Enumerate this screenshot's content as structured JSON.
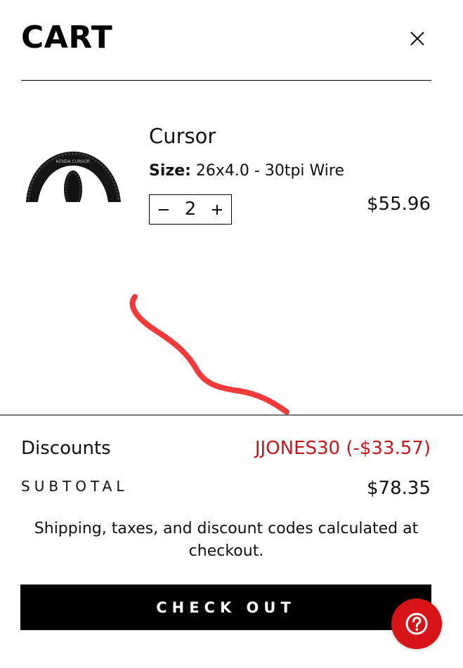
{
  "header": {
    "title": "CART",
    "close_icon": "close-icon"
  },
  "cart_item": {
    "name": "Cursor",
    "size_label": "Size:",
    "size_value": "26x4.0 - 30tpi Wire",
    "quantity": "2",
    "price": "$55.96",
    "decrease_icon": "minus-icon",
    "increase_icon": "plus-icon",
    "image_icon": "tire-image",
    "tire_brand_text": "KENDA CURSOR"
  },
  "summary": {
    "discounts_label": "Discounts",
    "discounts_value": "JJONES30 (-$33.57)",
    "subtotal_label": "SUBTOTAL",
    "subtotal_value": "$78.35",
    "shipping_note": "Shipping, taxes, and discount codes calculated at checkout."
  },
  "actions": {
    "checkout_label": "CHECK OUT",
    "help_icon": "help-icon"
  },
  "colors": {
    "accent_red": "#c4161c",
    "help_red": "#d61317",
    "scribble_red": "#f23a3a",
    "button_black": "#000000"
  }
}
